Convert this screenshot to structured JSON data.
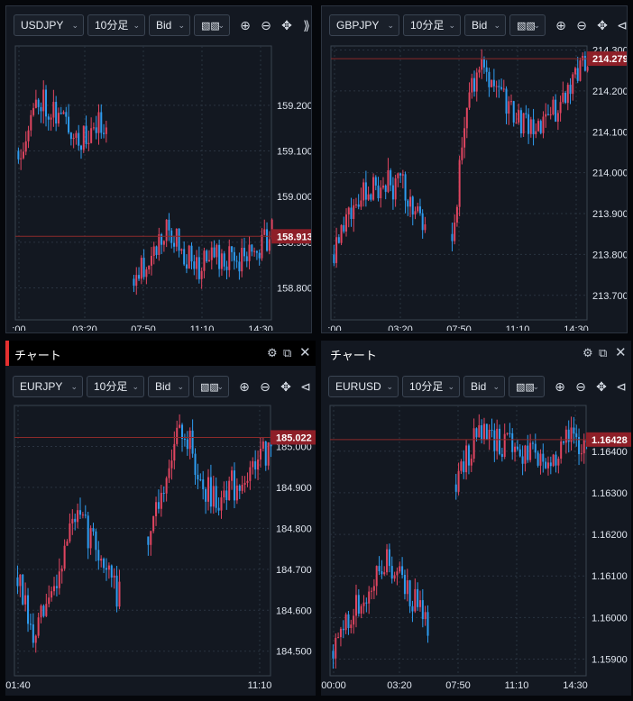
{
  "colors": {
    "up": "#e04560",
    "down": "#2e9cf0",
    "grid": "#2a3340",
    "price_line": "#8c2a2a",
    "price_badge": "#8e1f28"
  },
  "panels": [
    {
      "title": null,
      "toolbar": {
        "symbol": "USDJPY",
        "timeframe": "10分足",
        "price_type": "Bid",
        "overflow": "⟫"
      },
      "chart_data": {
        "type": "candlestick",
        "y_ticks": [
          "159.200",
          "159.100",
          "159.000",
          "158.900",
          "158.800"
        ],
        "x_ticks": [
          ":00",
          "03:20",
          "07:50",
          "11:10",
          "14:30"
        ],
        "current_price": "158.913",
        "ylim": [
          158.73,
          159.33
        ],
        "segments": [
          {
            "start": 159.1,
            "end": 159.17,
            "count": 36,
            "vol": 0.035,
            "seed": 11,
            "path": [
              [
                0,
                159.1
              ],
              [
                0.25,
                159.22
              ],
              [
                0.5,
                159.17
              ],
              [
                0.75,
                159.12
              ],
              [
                1,
                159.17
              ]
            ]
          },
          {
            "start": 158.82,
            "end": 158.92,
            "count": 56,
            "vol": 0.03,
            "seed": 23,
            "path": [
              [
                0,
                158.82
              ],
              [
                0.15,
                158.88
              ],
              [
                0.25,
                158.93
              ],
              [
                0.45,
                158.84
              ],
              [
                0.6,
                158.87
              ],
              [
                0.8,
                158.86
              ],
              [
                1,
                158.92
              ]
            ]
          }
        ]
      }
    },
    {
      "title": null,
      "toolbar": {
        "symbol": "GBPJPY",
        "timeframe": "10分足",
        "price_type": "Bid",
        "overflow": "⊲"
      },
      "chart_data": {
        "type": "candlestick",
        "y_ticks": [
          "214.300",
          "214.200",
          "214.100",
          "214.000",
          "213.900",
          "213.800",
          "213.700"
        ],
        "x_ticks": [
          ":00",
          "03:20",
          "07:50",
          "11:10",
          "14:30"
        ],
        "current_price": "214.279",
        "ylim": [
          213.64,
          214.31
        ],
        "segments": [
          {
            "start": 213.8,
            "end": 213.9,
            "count": 38,
            "vol": 0.04,
            "seed": 5,
            "path": [
              [
                0,
                213.8
              ],
              [
                0.25,
                213.93
              ],
              [
                0.5,
                213.98
              ],
              [
                0.75,
                213.96
              ],
              [
                1,
                213.88
              ]
            ]
          },
          {
            "start": 213.85,
            "end": 214.27,
            "count": 56,
            "vol": 0.035,
            "seed": 41,
            "path": [
              [
                0,
                213.85
              ],
              [
                0.12,
                214.18
              ],
              [
                0.2,
                214.27
              ],
              [
                0.45,
                214.15
              ],
              [
                0.6,
                214.1
              ],
              [
                0.8,
                214.17
              ],
              [
                1,
                214.27
              ]
            ]
          }
        ]
      }
    },
    {
      "title": "チャート",
      "toolbar": {
        "symbol": "EURJPY",
        "timeframe": "10分足",
        "price_type": "Bid",
        "overflow": "⊲"
      },
      "chart_data": {
        "type": "candlestick",
        "y_ticks": [
          "185.000",
          "184.900",
          "184.800",
          "184.700",
          "184.600",
          "184.500"
        ],
        "x_ticks": [
          "01:40",
          "11:10"
        ],
        "current_price": "185.022",
        "ylim": [
          184.44,
          185.1
        ],
        "segments": [
          {
            "start": 184.68,
            "end": 184.63,
            "count": 40,
            "vol": 0.04,
            "seed": 7,
            "path": [
              [
                0,
                184.68
              ],
              [
                0.15,
                184.52
              ],
              [
                0.35,
                184.65
              ],
              [
                0.55,
                184.83
              ],
              [
                0.75,
                184.77
              ],
              [
                1,
                184.63
              ]
            ]
          },
          {
            "start": 184.78,
            "end": 185.0,
            "count": 48,
            "vol": 0.04,
            "seed": 19,
            "path": [
              [
                0,
                184.78
              ],
              [
                0.2,
                185.0
              ],
              [
                0.3,
                185.04
              ],
              [
                0.45,
                184.9
              ],
              [
                0.6,
                184.88
              ],
              [
                0.75,
                184.92
              ],
              [
                1,
                185.0
              ]
            ]
          }
        ]
      }
    },
    {
      "title": "チャート",
      "toolbar": {
        "symbol": "EURUSD",
        "timeframe": "10分足",
        "price_type": "Bid",
        "overflow": "⊲"
      },
      "chart_data": {
        "type": "candlestick",
        "y_ticks": [
          "1.16400",
          "1.16300",
          "1.16200",
          "1.16100",
          "1.16000",
          "1.15900"
        ],
        "x_ticks": [
          "00:00",
          "03:20",
          "07:50",
          "11:10",
          "14:30"
        ],
        "current_price": "1.16428",
        "ylim": [
          1.1586,
          1.1651
        ],
        "segments": [
          {
            "start": 1.1592,
            "end": 1.1599,
            "count": 38,
            "vol": 0.00035,
            "seed": 3,
            "path": [
              [
                0,
                1.1592
              ],
              [
                0.3,
                1.1605
              ],
              [
                0.55,
                1.1614
              ],
              [
                0.75,
                1.1608
              ],
              [
                1,
                1.1599
              ]
            ]
          },
          {
            "start": 1.1632,
            "end": 1.1641,
            "count": 52,
            "vol": 0.00035,
            "seed": 29,
            "path": [
              [
                0,
                1.1632
              ],
              [
                0.15,
                1.1644
              ],
              [
                0.35,
                1.1642
              ],
              [
                0.55,
                1.1639
              ],
              [
                0.7,
                1.1637
              ],
              [
                0.85,
                1.1644
              ],
              [
                1,
                1.1641
              ]
            ]
          }
        ]
      }
    }
  ]
}
